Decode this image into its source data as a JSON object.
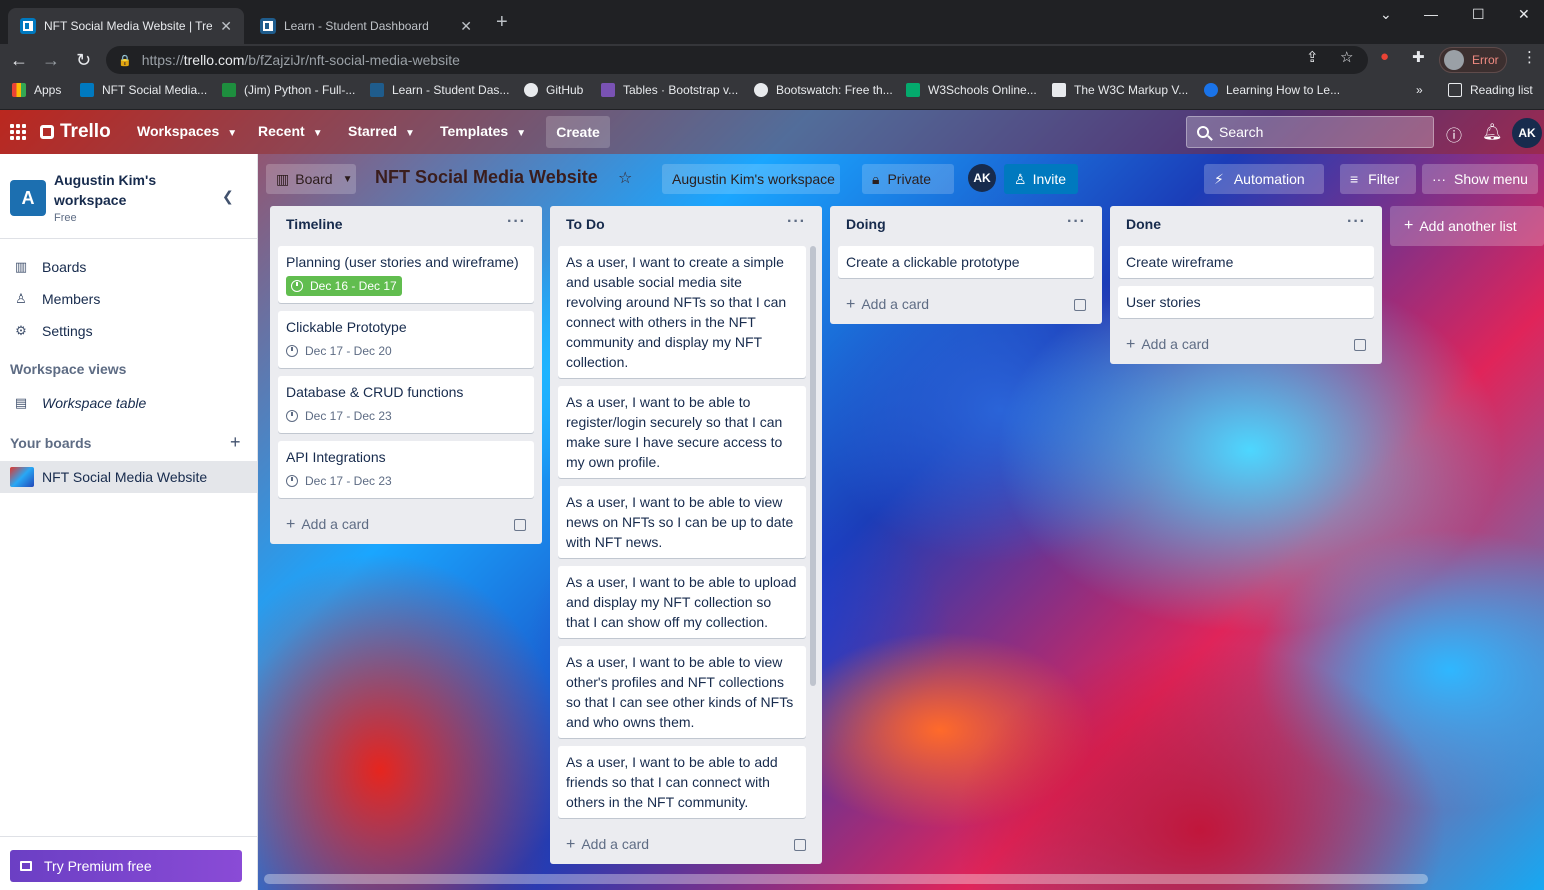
{
  "browser": {
    "tabs": [
      {
        "title": "NFT Social Media Website | Trello",
        "active": true
      },
      {
        "title": "Learn - Student Dashboard",
        "active": false
      }
    ],
    "url_host": "trello.com",
    "url_scheme": "https://",
    "url_path": "/b/fZajziJr/nft-social-media-website",
    "profile_status": "Error",
    "bookmarks": [
      "Apps",
      "NFT Social Media...",
      "(Jim) Python - Full-...",
      "Learn - Student Das...",
      "GitHub",
      "Tables · Bootstrap v...",
      "Bootswatch: Free th...",
      "W3Schools Online...",
      "The W3C Markup V...",
      "Learning How to Le..."
    ],
    "reading_list": "Reading list"
  },
  "trello": {
    "logo": "Trello",
    "nav": [
      "Workspaces",
      "Recent",
      "Starred",
      "Templates"
    ],
    "create": "Create",
    "search_placeholder": "Search",
    "user_initials": "AK"
  },
  "sidebar": {
    "workspace_initial": "A",
    "workspace_name": "Augustin Kim's workspace",
    "plan": "Free",
    "items": [
      "Boards",
      "Members",
      "Settings"
    ],
    "workspace_views_heading": "Workspace views",
    "workspace_table": "Workspace table",
    "your_boards_heading": "Your boards",
    "current_board": "NFT Social Media Website",
    "premium": "Try Premium free"
  },
  "board": {
    "view": "Board",
    "title": "NFT Social Media Website",
    "workspace": "Augustin Kim's workspace",
    "visibility": "Private",
    "member_initials": "AK",
    "invite": "Invite",
    "automation": "Automation",
    "filter": "Filter",
    "show_menu": "Show menu",
    "add_list": "Add another list",
    "add_card": "Add a card",
    "lists": [
      {
        "name": "Timeline",
        "cards": [
          {
            "text": "Planning (user stories and wireframe)",
            "dates": "Dec 16 - Dec 17",
            "due_complete": true
          },
          {
            "text": "Clickable Prototype",
            "dates": "Dec 17 - Dec 20"
          },
          {
            "text": "Database & CRUD functions",
            "dates": "Dec 17 - Dec 23"
          },
          {
            "text": "API Integrations",
            "dates": "Dec 17 - Dec 23"
          }
        ]
      },
      {
        "name": "To Do",
        "cards": [
          {
            "text": "As a user, I want to create a simple and usable social media site revolving around NFTs so that I can connect with others in the NFT community and display my NFT collection."
          },
          {
            "text": "As a user, I want to be able to register/login securely so that I can make sure I have secure access to my own profile."
          },
          {
            "text": "As a user, I want to be able to view news on NFTs so I can be up to date with NFT news."
          },
          {
            "text": "As a user, I want to be able to upload and display my NFT collection so that I can show off my collection."
          },
          {
            "text": "As a user, I want to be able to view other's profiles and NFT collections so that I can see other kinds of NFTs and who owns them."
          },
          {
            "text": "As a user, I want to be able to add friends so that I can connect with others in the NFT community."
          }
        ]
      },
      {
        "name": "Doing",
        "cards": [
          {
            "text": "Create a clickable prototype"
          }
        ]
      },
      {
        "name": "Done",
        "cards": [
          {
            "text": "Create wireframe"
          },
          {
            "text": "User stories"
          }
        ]
      }
    ]
  },
  "colors": {
    "trello_blue": "#0079bf",
    "due_complete_green": "#61bd4f",
    "premium_purple": "#8a4bd6"
  }
}
